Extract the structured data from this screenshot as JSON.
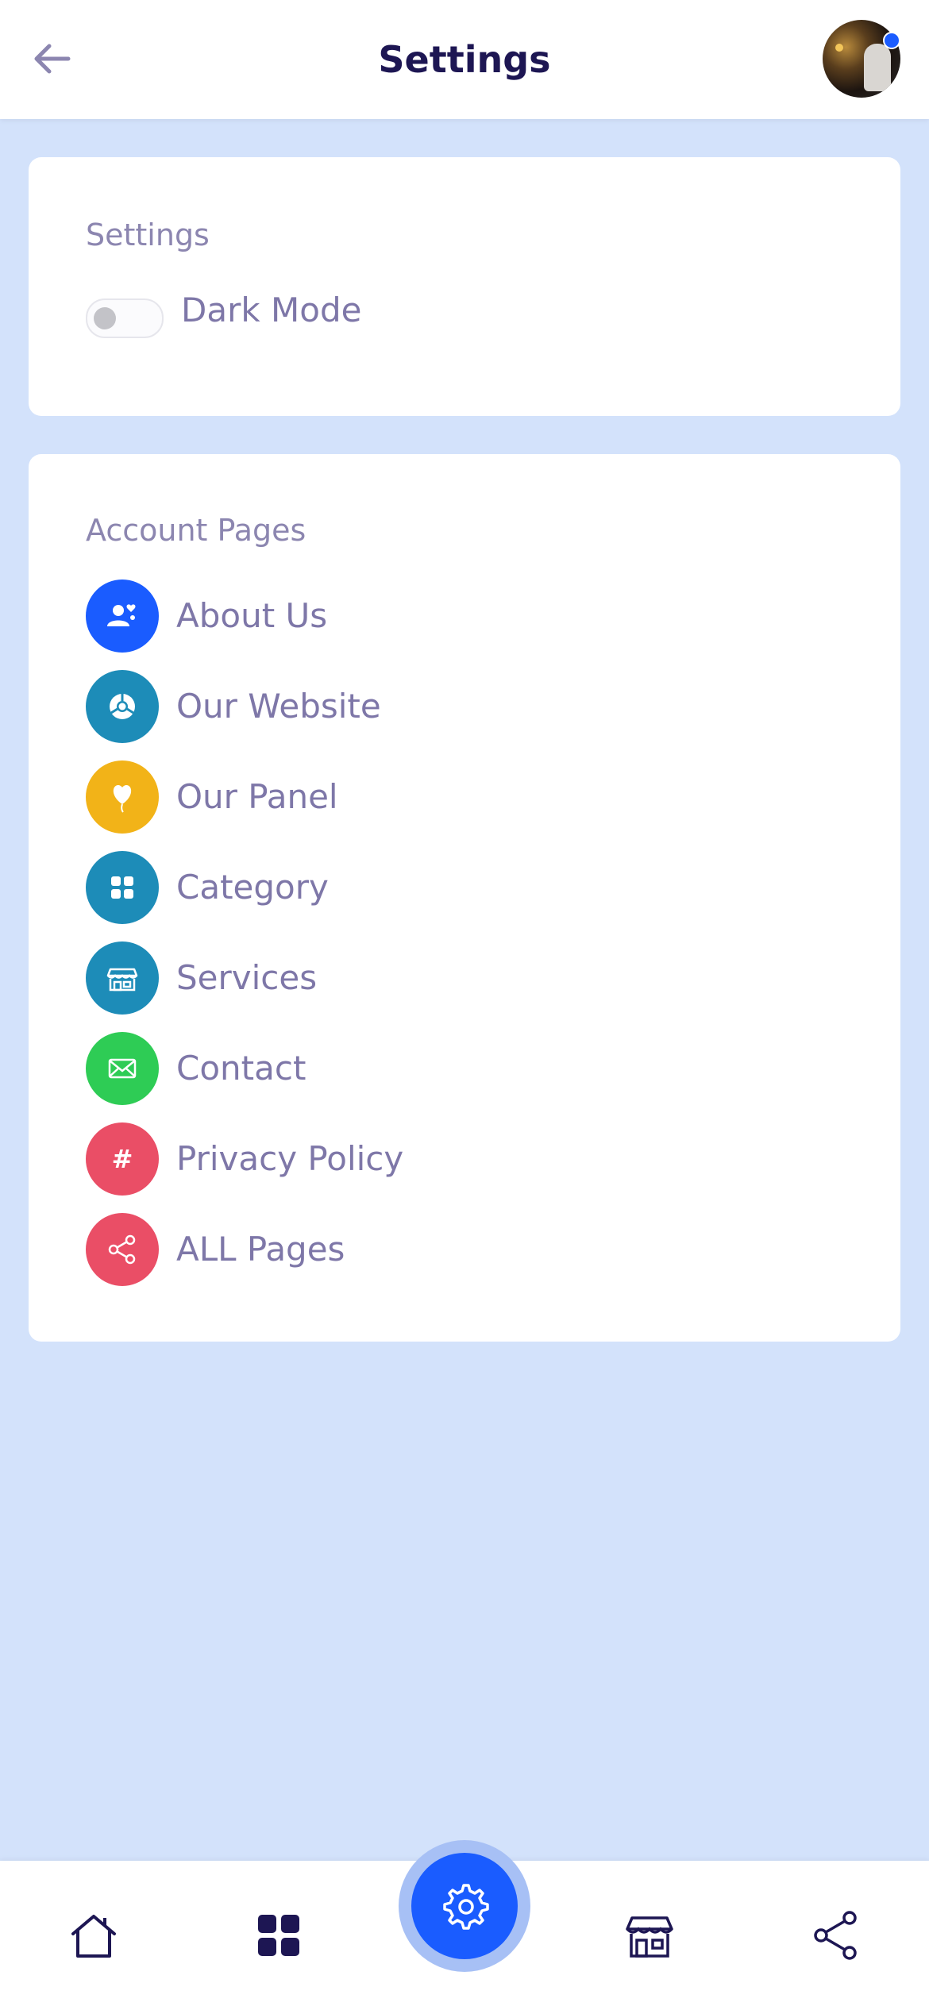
{
  "header": {
    "title": "Settings",
    "back_icon": "arrow-left-icon",
    "avatar_icon": "user-avatar",
    "status_color": "#1a5cff"
  },
  "settings_card": {
    "title": "Settings",
    "dark_mode_label": "Dark Mode",
    "dark_mode_on": false
  },
  "pages_card": {
    "title": "Account Pages",
    "items": [
      {
        "label": "About Us",
        "icon": "users-heart-icon",
        "color": "#1a5cff"
      },
      {
        "label": "Our Website",
        "icon": "chrome-icon",
        "color": "#1d8cb8"
      },
      {
        "label": "Our Panel",
        "icon": "heart-balloon-icon",
        "color": "#f2b318"
      },
      {
        "label": "Category",
        "icon": "grid-icon",
        "color": "#1d8cb8"
      },
      {
        "label": "Services",
        "icon": "storefront-icon",
        "color": "#1d8cb8"
      },
      {
        "label": "Contact",
        "icon": "envelope-icon",
        "color": "#2ecc55"
      },
      {
        "label": "Privacy Policy",
        "icon": "hash-icon",
        "color": "#ea4e66"
      },
      {
        "label": "ALL Pages",
        "icon": "share-icon",
        "color": "#ea4e66"
      }
    ]
  },
  "bottom_nav": {
    "items": [
      {
        "icon": "home-icon"
      },
      {
        "icon": "grid-icon"
      },
      {
        "icon": "gear-icon",
        "active": true
      },
      {
        "icon": "storefront-icon"
      },
      {
        "icon": "share-icon"
      }
    ],
    "accent": "#1a5cff"
  },
  "page_hash_symbol": "#"
}
